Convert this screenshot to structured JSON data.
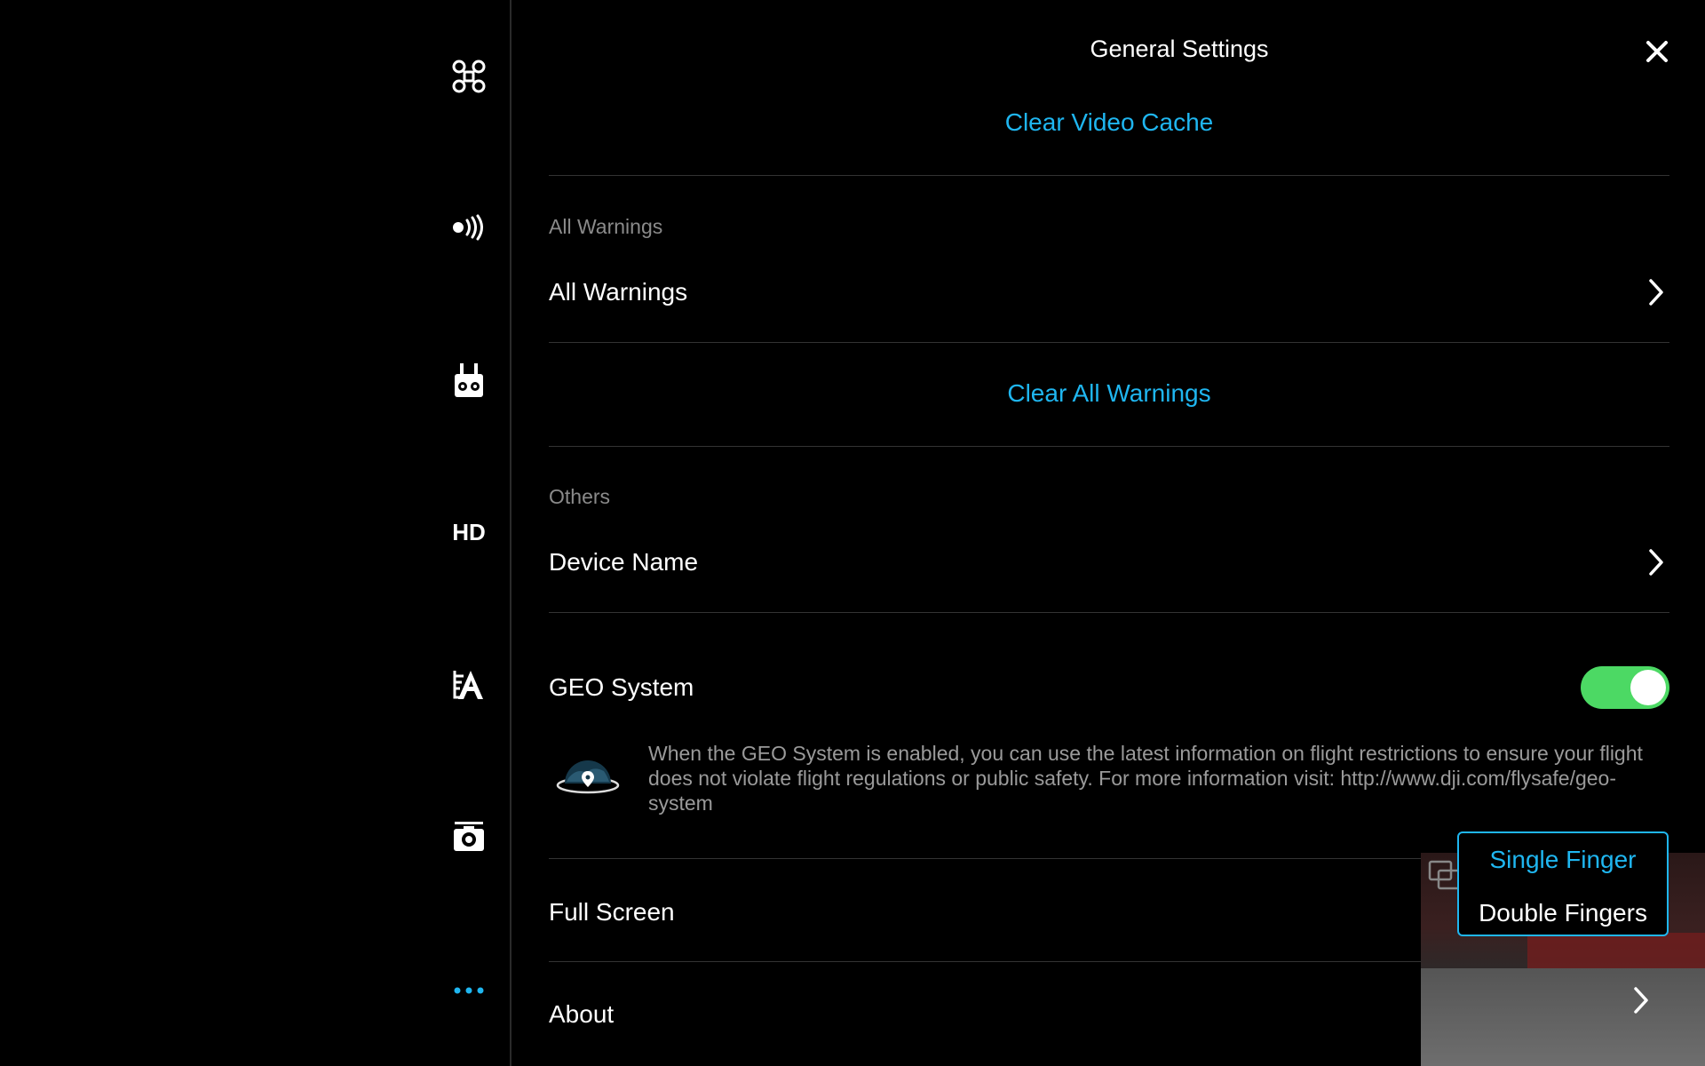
{
  "sidebar": {
    "items": [
      {
        "icon": "drone-icon"
      },
      {
        "icon": "signal-waves-icon"
      },
      {
        "icon": "remote-controller-icon"
      },
      {
        "icon": "hd-transmission-icon",
        "label": "HD"
      },
      {
        "icon": "battery-aircraft-icon"
      },
      {
        "icon": "camera-icon"
      },
      {
        "icon": "more-icon"
      }
    ],
    "accent": "#1fb6f0"
  },
  "header": {
    "title": "General Settings"
  },
  "actions": {
    "clear_video_cache": "Clear Video Cache",
    "clear_all_warnings": "Clear All Warnings"
  },
  "sections": {
    "warnings_label": "All Warnings",
    "others_label": "Others"
  },
  "rows": {
    "all_warnings": "All Warnings",
    "device_name": "Device Name",
    "geo_system": "GEO System",
    "full_screen": "Full Screen",
    "about": "About"
  },
  "geo": {
    "enabled": true,
    "description": "When the GEO System is enabled, you can use the latest information on flight restrictions to ensure your flight does not violate flight regulations or public safety. For more information visit: http://www.dji.com/flysafe/geo-system"
  },
  "full_screen_popup": {
    "options": [
      "Single Finger",
      "Double Fingers"
    ],
    "selected": "Single Finger"
  },
  "colors": {
    "accent": "#1fb6f0",
    "toggle_on": "#4cd964",
    "background": "#000000",
    "muted_text": "#8a8a8a"
  }
}
